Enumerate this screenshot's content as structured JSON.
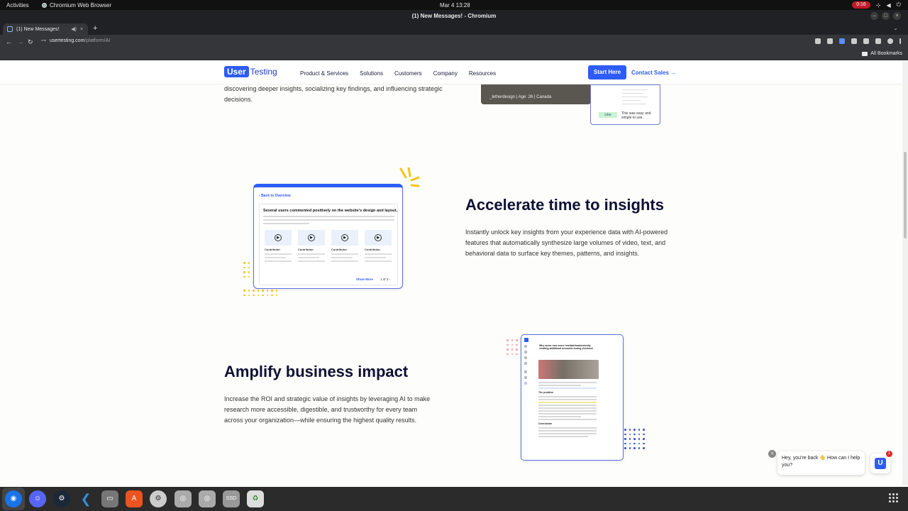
{
  "system": {
    "activities": "Activities",
    "app_name": "Chromium Web Browser",
    "clock": "Mar 4  13:28",
    "record_time": "0:16"
  },
  "browser": {
    "window_title": "(1) New Messages! - Chromium",
    "tab_title": "(1) New Messages!",
    "url_host": "usertesting.com",
    "url_path": "/platform/AI",
    "bookmarks_label": "All Bookmarks"
  },
  "site": {
    "logo_box": "User",
    "logo_text": "Testing",
    "menu": [
      "Product & Services",
      "Solutions",
      "Customers",
      "Company",
      "Resources"
    ],
    "start_label": "Start Here",
    "contact_label": "Contact Sales →"
  },
  "previous_section": {
    "text": "discovering deeper insights, socializing key findings, and influencing strategic decisions.",
    "image_caption": "_letherdesign  |  Age: 26  |  Canada",
    "like_label": "Like",
    "note": "This was easy and simple to use."
  },
  "section_accelerate": {
    "title": "Accelerate time to insights",
    "body": "Instantly unlock key insights from your experience data with AI-powered features that automatically synthesize large volumes of video, text, and behavioral data to surface key themes, patterns, and insights.",
    "mock": {
      "back": "Back to Overview",
      "headline": "Several users commented positively on the website's design and layout.",
      "contributor": "Contributor",
      "show_more": "Show More",
      "pager": "1 of 3"
    }
  },
  "section_amplify": {
    "title": "Amplify business impact",
    "body": "Increase the ROI and strategic value of insights by leveraging AI to make research more accessible, digestible, and trustworthy for every team across your organization—while ensuring the highest quality results.",
    "mock": {
      "title": "Why some new users hesitate/inadvertently creating additional accounts during checkout",
      "problem": "The problem",
      "conclusion": "Conclusion"
    }
  },
  "chat": {
    "message": "Hey, you're back 👋 How can I help you?",
    "badge": "1",
    "logo": "U"
  },
  "colors": {
    "brand_blue": "#2d5cf6",
    "heading_navy": "#0e1133",
    "accent_yellow": "#f5c518"
  }
}
